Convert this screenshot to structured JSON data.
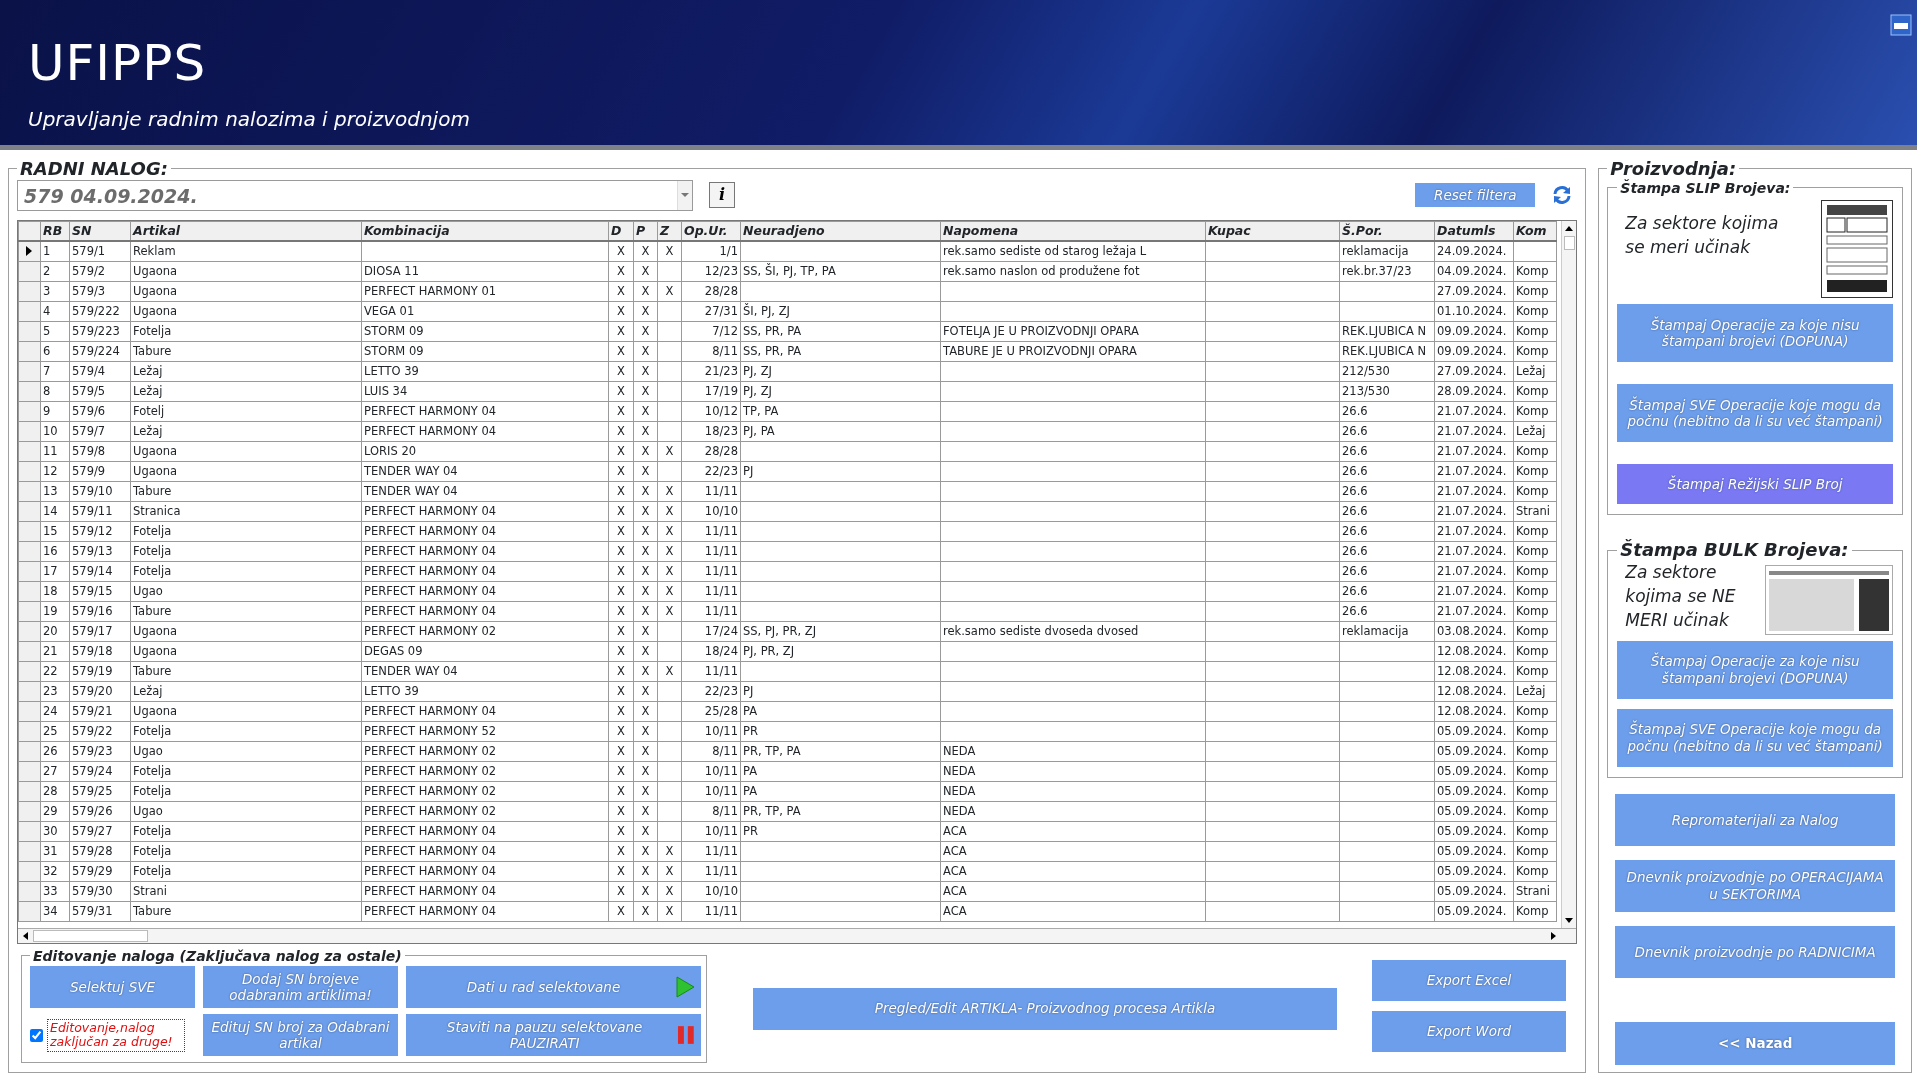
{
  "app": {
    "title": "UFIPPS",
    "subtitle": "Upravljanje radnim nalozima i proizvodnjom"
  },
  "work_order": {
    "label": "RADNI NALOG:",
    "value": "579 04.09.2024.",
    "info_button": "i",
    "reset_button": "Reset filtera"
  },
  "table": {
    "columns": [
      "RB",
      "SN",
      "Artikal",
      "Kombinacija",
      "D",
      "P",
      "Z",
      "Op.Ur.",
      "Neuradjeno",
      "Napomena",
      "Kupac",
      "Š.Por.",
      "Datumls",
      "Kom"
    ],
    "rows": [
      {
        "selected": true,
        "rb": "1",
        "sn": "579/1",
        "art": "Reklam",
        "d": "X",
        "p": "X",
        "z": "X",
        "op": "1/1",
        "nap": "rek.samo sediste od starog ležaja L",
        "spor": "reklamacija",
        "dat": "24.09.2024."
      },
      {
        "selected": false,
        "rb": "2",
        "sn": "579/2",
        "art": "Ugaona",
        "komb": "DIOSA 11",
        "d": "X",
        "p": "X",
        "op": "12/23",
        "neu": "SS, ŠI, PJ, TP, PA",
        "nap": "rek.samo naslon od produžene fot",
        "spor": "rek.br.37/23",
        "dat": "04.09.2024.",
        "kom": "Komp"
      },
      {
        "selected": false,
        "rb": "3",
        "sn": "579/3",
        "art": "Ugaona",
        "komb": "PERFECT HARMONY 01",
        "d": "X",
        "p": "X",
        "z": "X",
        "op": "28/28",
        "dat": "27.09.2024.",
        "kom": "Komp"
      },
      {
        "selected": false,
        "rb": "4",
        "sn": "579/222",
        "art": "Ugaona",
        "komb": "VEGA 01",
        "d": "X",
        "p": "X",
        "op": "27/31",
        "neu": "ŠI, PJ, ZJ",
        "dat": "01.10.2024.",
        "kom": "Komp"
      },
      {
        "selected": false,
        "rb": "5",
        "sn": "579/223",
        "art": "Fotelja",
        "komb": "STORM 09",
        "d": "X",
        "p": "X",
        "op": "7/12",
        "neu": "SS, PR, PA",
        "nap": "FOTELJA JE U PROIZVODNJI OPARA",
        "spor": "REK.LJUBICA N",
        "dat": "09.09.2024.",
        "kom": "Komp"
      },
      {
        "selected": false,
        "rb": "6",
        "sn": "579/224",
        "art": "Tabure",
        "komb": "STORM 09",
        "d": "X",
        "p": "X",
        "op": "8/11",
        "neu": "SS, PR, PA",
        "nap": "TABURE JE U PROIZVODNJI OPARA",
        "spor": "REK.LJUBICA N",
        "dat": "09.09.2024.",
        "kom": "Komp"
      },
      {
        "selected": false,
        "rb": "7",
        "sn": "579/4",
        "art": "Ležaj",
        "komb": "LETTO 39",
        "d": "X",
        "p": "X",
        "op": "21/23",
        "neu": "PJ, ZJ",
        "spor": "212/530",
        "dat": "27.09.2024.",
        "kom": "Ležaj"
      },
      {
        "selected": false,
        "rb": "8",
        "sn": "579/5",
        "art": "Ležaj",
        "komb": "LUIS 34",
        "d": "X",
        "p": "X",
        "op": "17/19",
        "neu": "PJ, ZJ",
        "spor": "213/530",
        "dat": "28.09.2024.",
        "kom": "Komp"
      },
      {
        "selected": false,
        "rb": "9",
        "sn": "579/6",
        "art": "Fotelj",
        "komb": "PERFECT HARMONY 04",
        "d": "X",
        "p": "X",
        "op": "10/12",
        "neu": "TP, PA",
        "spor": "26.6",
        "dat": "21.07.2024.",
        "kom": "Komp"
      },
      {
        "selected": false,
        "rb": "10",
        "sn": "579/7",
        "art": "Ležaj",
        "komb": "PERFECT HARMONY 04",
        "d": "X",
        "p": "X",
        "op": "18/23",
        "neu": "PJ, PA",
        "spor": "26.6",
        "dat": "21.07.2024.",
        "kom": "Ležaj"
      },
      {
        "selected": false,
        "rb": "11",
        "sn": "579/8",
        "art": "Ugaona",
        "komb": "LORIS 20",
        "d": "X",
        "p": "X",
        "z": "X",
        "op": "28/28",
        "spor": "26.6",
        "dat": "21.07.2024.",
        "kom": "Komp"
      },
      {
        "selected": false,
        "rb": "12",
        "sn": "579/9",
        "art": "Ugaona",
        "komb": "TENDER WAY 04",
        "d": "X",
        "p": "X",
        "op": "22/23",
        "neu": "PJ",
        "spor": "26.6",
        "dat": "21.07.2024.",
        "kom": "Komp"
      },
      {
        "selected": false,
        "rb": "13",
        "sn": "579/10",
        "art": "Tabure",
        "komb": "TENDER WAY 04",
        "d": "X",
        "p": "X",
        "z": "X",
        "op": "11/11",
        "spor": "26.6",
        "dat": "21.07.2024.",
        "kom": "Komp"
      },
      {
        "selected": false,
        "rb": "14",
        "sn": "579/11",
        "art": "Stranica",
        "komb": "PERFECT HARMONY 04",
        "d": "X",
        "p": "X",
        "z": "X",
        "op": "10/10",
        "spor": "26.6",
        "dat": "21.07.2024.",
        "kom": "Strani"
      },
      {
        "selected": false,
        "rb": "15",
        "sn": "579/12",
        "art": "Fotelja",
        "komb": "PERFECT HARMONY 04",
        "d": "X",
        "p": "X",
        "z": "X",
        "op": "11/11",
        "spor": "26.6",
        "dat": "21.07.2024.",
        "kom": "Komp"
      },
      {
        "selected": false,
        "rb": "16",
        "sn": "579/13",
        "art": "Fotelja",
        "komb": "PERFECT HARMONY 04",
        "d": "X",
        "p": "X",
        "z": "X",
        "op": "11/11",
        "spor": "26.6",
        "dat": "21.07.2024.",
        "kom": "Komp"
      },
      {
        "selected": false,
        "rb": "17",
        "sn": "579/14",
        "art": "Fotelja",
        "komb": "PERFECT HARMONY 04",
        "d": "X",
        "p": "X",
        "z": "X",
        "op": "11/11",
        "spor": "26.6",
        "dat": "21.07.2024.",
        "kom": "Komp"
      },
      {
        "selected": false,
        "rb": "18",
        "sn": "579/15",
        "art": "Ugao",
        "komb": "PERFECT HARMONY 04",
        "d": "X",
        "p": "X",
        "z": "X",
        "op": "11/11",
        "spor": "26.6",
        "dat": "21.07.2024.",
        "kom": "Komp"
      },
      {
        "selected": false,
        "rb": "19",
        "sn": "579/16",
        "art": "Tabure",
        "komb": "PERFECT HARMONY 04",
        "d": "X",
        "p": "X",
        "z": "X",
        "op": "11/11",
        "spor": "26.6",
        "dat": "21.07.2024.",
        "kom": "Komp"
      },
      {
        "selected": false,
        "rb": "20",
        "sn": "579/17",
        "art": "Ugaona",
        "komb": "PERFECT HARMONY 02",
        "d": "X",
        "p": "X",
        "op": "17/24",
        "neu": "SS, PJ, PR, ZJ",
        "nap": "rek.samo sediste dvoseda dvosed",
        "spor": "reklamacija",
        "dat": "03.08.2024.",
        "kom": "Komp"
      },
      {
        "selected": false,
        "rb": "21",
        "sn": "579/18",
        "art": "Ugaona",
        "komb": "DEGAS 09",
        "d": "X",
        "p": "X",
        "op": "18/24",
        "neu": "PJ, PR, ZJ",
        "dat": "12.08.2024.",
        "kom": "Komp"
      },
      {
        "selected": false,
        "rb": "22",
        "sn": "579/19",
        "art": "Tabure",
        "komb": "TENDER WAY 04",
        "d": "X",
        "p": "X",
        "z": "X",
        "op": "11/11",
        "dat": "12.08.2024.",
        "kom": "Komp"
      },
      {
        "selected": false,
        "rb": "23",
        "sn": "579/20",
        "art": "Ležaj",
        "komb": "LETTO 39",
        "d": "X",
        "p": "X",
        "op": "22/23",
        "neu": "PJ",
        "dat": "12.08.2024.",
        "kom": "Ležaj"
      },
      {
        "selected": false,
        "rb": "24",
        "sn": "579/21",
        "art": "Ugaona",
        "komb": "PERFECT HARMONY 04",
        "d": "X",
        "p": "X",
        "op": "25/28",
        "neu": "PA",
        "dat": "12.08.2024.",
        "kom": "Komp"
      },
      {
        "selected": false,
        "rb": "25",
        "sn": "579/22",
        "art": "Fotelja",
        "komb": "PERFECT HARMONY 52",
        "d": "X",
        "p": "X",
        "op": "10/11",
        "neu": "PR",
        "dat": "05.09.2024.",
        "kom": "Komp"
      },
      {
        "selected": false,
        "rb": "26",
        "sn": "579/23",
        "art": "Ugao",
        "komb": "PERFECT HARMONY 02",
        "d": "X",
        "p": "X",
        "op": "8/11",
        "neu": "PR, TP, PA",
        "nap": "NEDA",
        "dat": "05.09.2024.",
        "kom": "Komp"
      },
      {
        "selected": false,
        "rb": "27",
        "sn": "579/24",
        "art": "Fotelja",
        "komb": "PERFECT HARMONY 02",
        "d": "X",
        "p": "X",
        "op": "10/11",
        "neu": "PA",
        "nap": "NEDA",
        "dat": "05.09.2024.",
        "kom": "Komp"
      },
      {
        "selected": false,
        "rb": "28",
        "sn": "579/25",
        "art": "Fotelja",
        "komb": "PERFECT HARMONY 02",
        "d": "X",
        "p": "X",
        "op": "10/11",
        "neu": "PA",
        "nap": "NEDA",
        "dat": "05.09.2024.",
        "kom": "Komp"
      },
      {
        "selected": false,
        "rb": "29",
        "sn": "579/26",
        "art": "Ugao",
        "komb": "PERFECT HARMONY 02",
        "d": "X",
        "p": "X",
        "op": "8/11",
        "neu": "PR, TP, PA",
        "nap": "NEDA",
        "dat": "05.09.2024.",
        "kom": "Komp"
      },
      {
        "selected": false,
        "rb": "30",
        "sn": "579/27",
        "art": "Fotelja",
        "komb": "PERFECT HARMONY 04",
        "d": "X",
        "p": "X",
        "op": "10/11",
        "neu": "PR",
        "nap": "ACA",
        "dat": "05.09.2024.",
        "kom": "Komp"
      },
      {
        "selected": false,
        "rb": "31",
        "sn": "579/28",
        "art": "Fotelja",
        "komb": "PERFECT HARMONY 04",
        "d": "X",
        "p": "X",
        "z": "X",
        "op": "11/11",
        "nap": "ACA",
        "dat": "05.09.2024.",
        "kom": "Komp"
      },
      {
        "selected": false,
        "rb": "32",
        "sn": "579/29",
        "art": "Fotelja",
        "komb": "PERFECT HARMONY 04",
        "d": "X",
        "p": "X",
        "z": "X",
        "op": "11/11",
        "nap": "ACA",
        "dat": "05.09.2024.",
        "kom": "Komp"
      },
      {
        "selected": false,
        "rb": "33",
        "sn": "579/30",
        "art": "Strani",
        "komb": "PERFECT HARMONY 04",
        "d": "X",
        "p": "X",
        "z": "X",
        "op": "10/10",
        "nap": "ACA",
        "dat": "05.09.2024.",
        "kom": "Strani"
      },
      {
        "selected": false,
        "rb": "34",
        "sn": "579/31",
        "art": "Tabure",
        "komb": "PERFECT HARMONY 04",
        "d": "X",
        "p": "X",
        "z": "X",
        "op": "11/11",
        "nap": "ACA",
        "dat": "05.09.2024.",
        "kom": "Komp"
      }
    ]
  },
  "editing": {
    "title": "Editovanje naloga (Zaključava nalog za ostale)",
    "select_all": "Selektuj SVE",
    "add_sn": "Dodaj  SN brojeve odabranim artiklima!",
    "edit_sn": "Edituj SN broj za  Odabrani artikal",
    "start": "Dati u rad selektovane",
    "pause": "Staviti na pauzu  selektovane PAUZIRATI",
    "lock": {
      "label": "Editovanje,nalog zaključan za druge!",
      "checked": true
    }
  },
  "article_button": "Pregled/Edit  ARTIKLA- Proizvodnog procesa Artikla",
  "export_buttons": [
    "Export Excel",
    "Export Word"
  ],
  "production": {
    "title": "Proizvodnja:",
    "slip": {
      "title": "Štampa SLIP Brojeva:",
      "description": "Za sektore kojima se meri učinak",
      "buttons": [
        {
          "label": "Štampaj Operacije  za koje nisu štampani brojevi  (DOPUNA)",
          "kind": "normal"
        },
        {
          "label": "Štampaj SVE Operacije koje mogu da počnu (nebitno da li su već štampani)",
          "kind": "normal"
        },
        {
          "label": "Štampaj Režijski SLIP Broj",
          "kind": "special"
        }
      ]
    },
    "bulk": {
      "title": "Štampa BULK Brojeva:",
      "description": "Za sektore kojima se NE MERI  učinak",
      "buttons": [
        {
          "label": "Štampaj Operacije  za koje nisu štampani brojevi (DOPUNA)",
          "kind": "normal"
        },
        {
          "label": "Štampaj SVE Operacije koje mogu da počnu (nebitno da li su već štampani)",
          "kind": "normal"
        }
      ]
    },
    "buttons": [
      {
        "label": "Repromaterijali za Nalog",
        "kind": "normal"
      },
      {
        "label": "Dnevnik  proizvodnje po OPERACIJAMA u SEKTORIMA",
        "kind": "normal"
      },
      {
        "label": "Dnevnik  proizvodnje po RADNICIMA",
        "kind": "normal"
      },
      {
        "label": "<< Nazad",
        "kind": "back"
      }
    ]
  }
}
